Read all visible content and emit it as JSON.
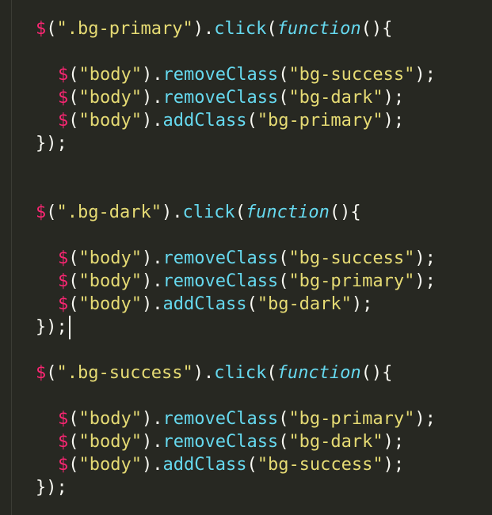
{
  "colors": {
    "background": "#272822",
    "dollar": "#f92672",
    "string": "#e6db74",
    "method": "#66d9ef",
    "keyword": "#66d9ef",
    "punctuation": "#f8f8f2"
  },
  "blocks": [
    {
      "handler": {
        "selector": "\".bg-primary\"",
        "method": "click",
        "keyword": "function"
      },
      "statements": [
        {
          "target": "\"body\"",
          "method": "removeClass",
          "arg": "\"bg-success\""
        },
        {
          "target": "\"body\"",
          "method": "removeClass",
          "arg": "\"bg-dark\""
        },
        {
          "target": "\"body\"",
          "method": "addClass",
          "arg": "\"bg-primary\""
        }
      ]
    },
    {
      "handler": {
        "selector": "\".bg-dark\"",
        "method": "click",
        "keyword": "function"
      },
      "statements": [
        {
          "target": "\"body\"",
          "method": "removeClass",
          "arg": "\"bg-success\""
        },
        {
          "target": "\"body\"",
          "method": "removeClass",
          "arg": "\"bg-primary\""
        },
        {
          "target": "\"body\"",
          "method": "addClass",
          "arg": "\"bg-dark\""
        }
      ]
    },
    {
      "handler": {
        "selector": "\".bg-success\"",
        "method": "click",
        "keyword": "function"
      },
      "statements": [
        {
          "target": "\"body\"",
          "method": "removeClass",
          "arg": "\"bg-primary\""
        },
        {
          "target": "\"body\"",
          "method": "removeClass",
          "arg": "\"bg-dark\""
        },
        {
          "target": "\"body\"",
          "method": "addClass",
          "arg": "\"bg-success\""
        }
      ]
    }
  ]
}
